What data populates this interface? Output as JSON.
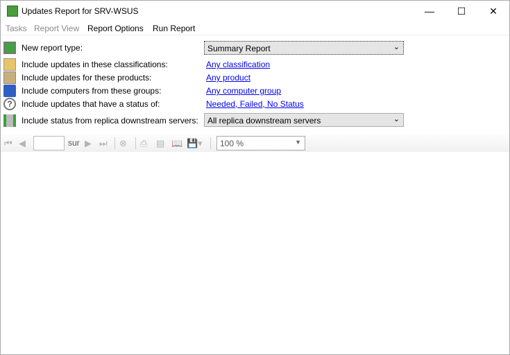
{
  "window": {
    "title": "Updates Report for SRV-WSUS"
  },
  "menu": {
    "tasks": "Tasks",
    "report_view": "Report View",
    "report_options": "Report Options",
    "run_report": "Run Report"
  },
  "options": {
    "report_type": {
      "label": "New report type:",
      "value": "Summary Report"
    },
    "classifications": {
      "label": "Include updates in these classifications:",
      "value": "Any classification"
    },
    "products": {
      "label": "Include updates for these products:",
      "value": "Any product"
    },
    "groups": {
      "label": "Include computers from these groups:",
      "value": "Any computer group"
    },
    "status": {
      "label": "Include updates that have a status of:",
      "value": "Needed, Failed, No Status"
    },
    "replica": {
      "label": "Include status from replica downstream servers:",
      "value": "All replica downstream servers"
    }
  },
  "toolbar": {
    "page_value": "",
    "of_label": "sur",
    "zoom": "100 %"
  }
}
